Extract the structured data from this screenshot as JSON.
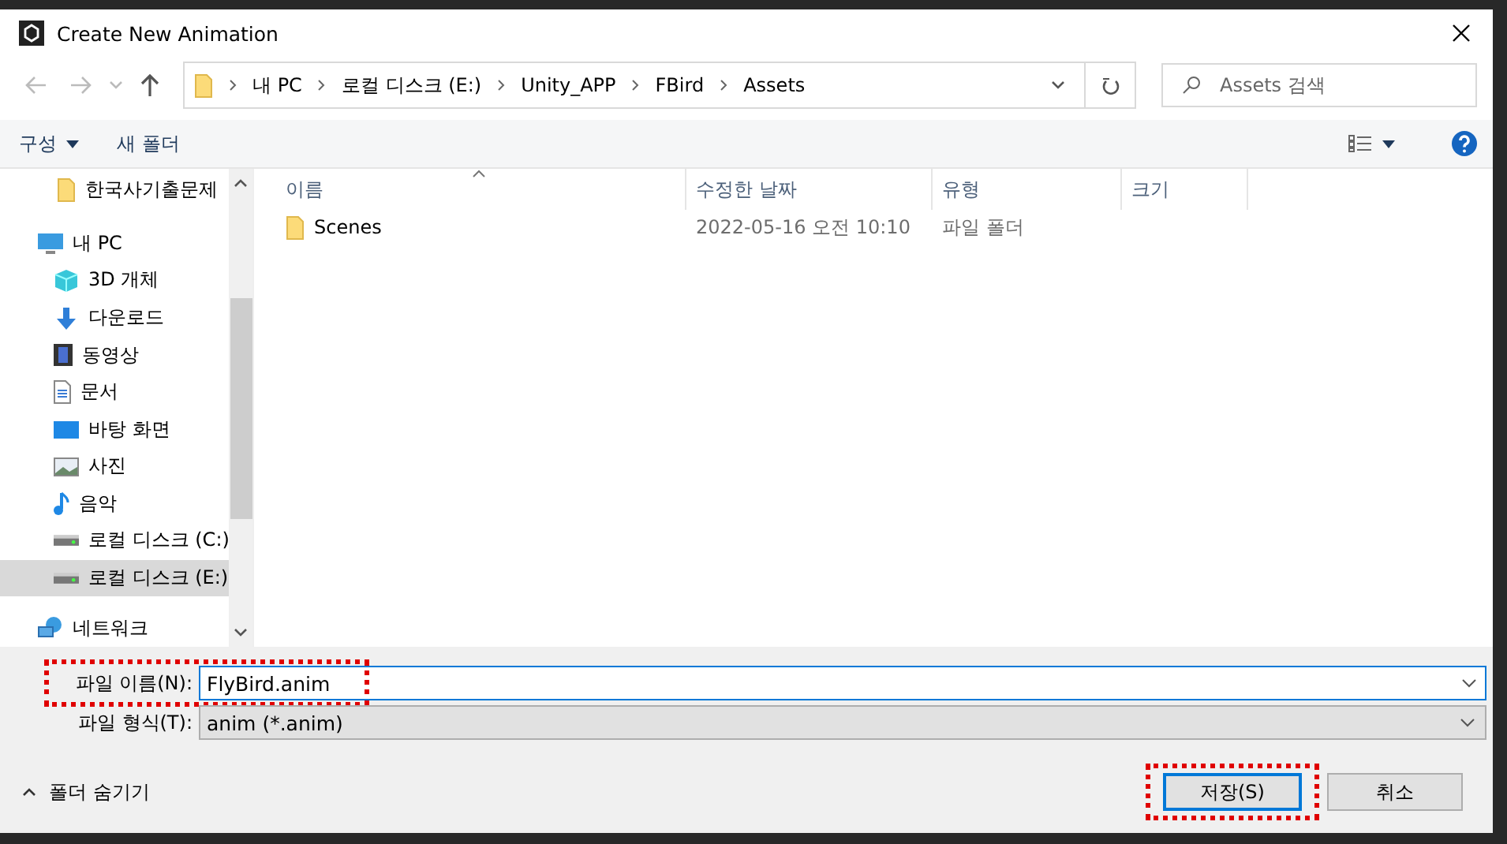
{
  "window": {
    "title": "Create New Animation"
  },
  "address": {
    "path": [
      "내 PC",
      "로컬 디스크 (E:)",
      "Unity_APP",
      "FBird",
      "Assets"
    ]
  },
  "search": {
    "placeholder": "Assets 검색"
  },
  "toolbar": {
    "organize": "구성",
    "new_folder": "새 폴더"
  },
  "sidebar": {
    "items": [
      {
        "label": "한국사기출문제",
        "selected": false
      },
      {
        "label": "내 PC",
        "selected": false,
        "children": [
          {
            "label": "3D 개체",
            "selected": false
          },
          {
            "label": "다운로드",
            "selected": false
          },
          {
            "label": "동영상",
            "selected": false
          },
          {
            "label": "문서",
            "selected": false
          },
          {
            "label": "바탕 화면",
            "selected": false
          },
          {
            "label": "사진",
            "selected": false
          },
          {
            "label": "음악",
            "selected": false
          },
          {
            "label": "로컬 디스크 (C:)",
            "selected": false
          },
          {
            "label": "로컬 디스크 (E:)",
            "selected": true
          }
        ]
      },
      {
        "label": "네트워크",
        "selected": false
      }
    ]
  },
  "table": {
    "columns": [
      "이름",
      "수정한 날짜",
      "유형",
      "크기"
    ],
    "rows": [
      {
        "name": "Scenes",
        "modified": "2022-05-16 오전 10:10",
        "type": "파일 폴더"
      }
    ]
  },
  "form": {
    "file_name_label": "파일 이름(N):",
    "file_name": "FlyBird.anim",
    "file_name_highlighted": true,
    "file_type_label": "파일 형식(T):",
    "file_type": "anim (*.anim)"
  },
  "footer": {
    "hide_folders": "폴더 숨기기",
    "buttons": [
      {
        "label": "저장(S)",
        "kind": "primary",
        "highlighted": true
      },
      {
        "label": "취소",
        "kind": "secondary",
        "highlighted": false
      }
    ]
  }
}
